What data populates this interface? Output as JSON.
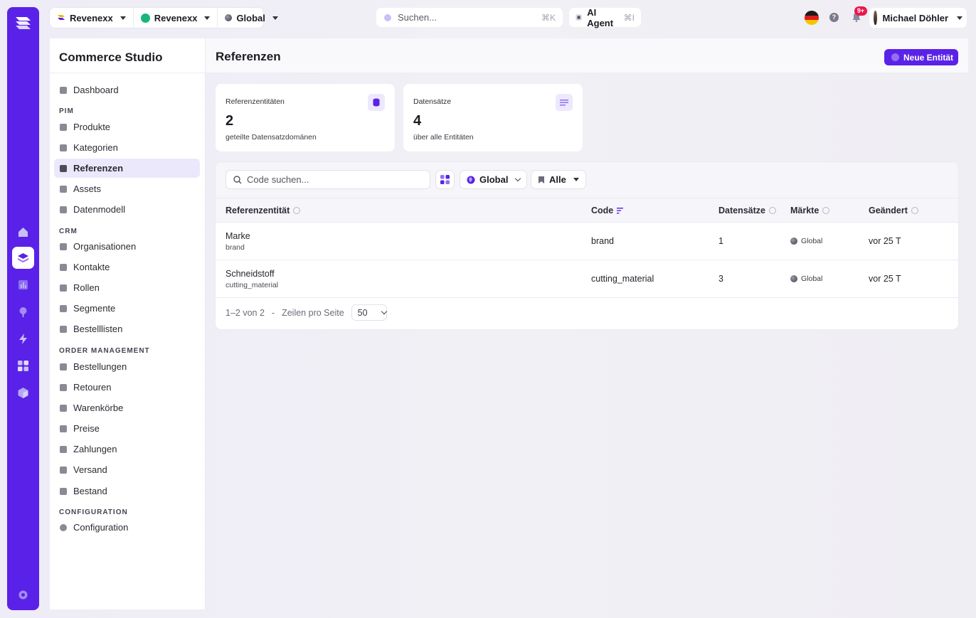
{
  "topbar": {
    "org": "Revenexx",
    "store": "Revenexx",
    "scope": "Global",
    "search_placeholder": "Suchen...",
    "search_shortcut": "⌘K",
    "agent_label": "AI Agent",
    "agent_shortcut": "⌘I",
    "notifications_badge": "9+",
    "user_name": "Michael Döhler",
    "help": "?"
  },
  "sidebar": {
    "title": "Commerce Studio",
    "dashboard": "Dashboard",
    "sections": {
      "pim": "PIM",
      "crm": "CRM",
      "order": "ORDER MANAGEMENT",
      "config": "CONFIGURATION"
    },
    "pim_items": [
      "Produkte",
      "Kategorien",
      "Referenzen",
      "Assets",
      "Datenmodell"
    ],
    "crm_items": [
      "Organisationen",
      "Kontakte",
      "Rollen",
      "Segmente",
      "Bestelllisten"
    ],
    "order_items": [
      "Bestellungen",
      "Retouren",
      "Warenkörbe",
      "Preise",
      "Zahlungen",
      "Versand",
      "Bestand"
    ],
    "config_items": [
      "Configuration"
    ]
  },
  "page": {
    "title": "Referenzen",
    "new_button": "Neue Entität"
  },
  "cards": [
    {
      "label": "Referenzentitäten",
      "value": "2",
      "sub": "geteilte Datensatzdomänen"
    },
    {
      "label": "Datensätze",
      "value": "4",
      "sub": "über alle Entitäten"
    }
  ],
  "filters": {
    "search_placeholder": "Code suchen...",
    "scope": "Global",
    "status": "Alle"
  },
  "table": {
    "headers": [
      "Referenzentität",
      "Code",
      "Datensätze",
      "Märkte",
      "Geändert"
    ],
    "rows": [
      {
        "name": "Marke",
        "sub": "brand",
        "code": "brand",
        "count": "1",
        "market": "Global",
        "changed": "vor 25 T"
      },
      {
        "name": "Schneidstoff",
        "sub": "cutting_material",
        "code": "cutting_material",
        "count": "3",
        "market": "Global",
        "changed": "vor 25 T"
      }
    ]
  },
  "pager": {
    "range": "1–2 von 2",
    "sep": "-",
    "per_page_label": "Zeilen pro Seite",
    "per_page": "50"
  },
  "colors": {
    "brand": "#5a22e8",
    "active_nav": "#ece8fb"
  }
}
